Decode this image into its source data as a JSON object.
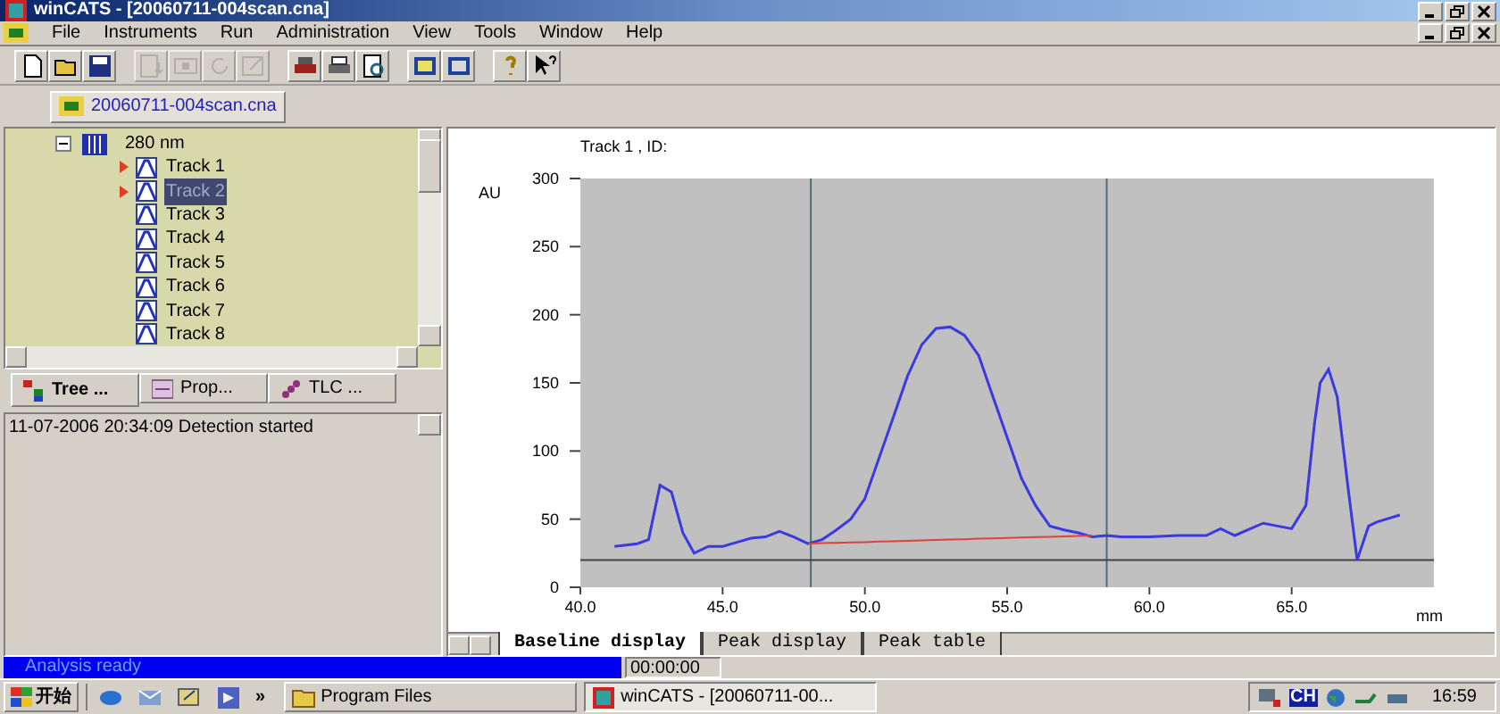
{
  "window": {
    "title": "winCATS - [20060711-004scan.cna]"
  },
  "menu": [
    "File",
    "Instruments",
    "Run",
    "Administration",
    "View",
    "Tools",
    "Window",
    "Help"
  ],
  "toolbar": [
    [
      {
        "kind": "new",
        "disabled": false
      },
      {
        "kind": "open",
        "disabled": false
      },
      {
        "kind": "save",
        "disabled": false
      }
    ],
    [
      {
        "kind": "list",
        "disabled": true
      },
      {
        "kind": "panel",
        "disabled": true
      },
      {
        "kind": "refresh",
        "disabled": true
      },
      {
        "kind": "edit",
        "disabled": true
      }
    ],
    [
      {
        "kind": "printer",
        "disabled": false
      },
      {
        "kind": "print",
        "disabled": false
      },
      {
        "kind": "preview",
        "disabled": false
      }
    ],
    [
      {
        "kind": "frame",
        "disabled": false
      },
      {
        "kind": "window",
        "disabled": false
      }
    ],
    [
      {
        "kind": "help",
        "disabled": false
      },
      {
        "kind": "context-help",
        "disabled": false
      }
    ]
  ],
  "document_tabs": [
    {
      "label": "20060711-004scan.cna",
      "selected": true
    }
  ],
  "tree": {
    "items": [
      {
        "label": "280 nm",
        "expanded": true,
        "children": [
          {
            "label": "Track 1",
            "marked": true,
            "selected": false
          },
          {
            "label": "Track 2",
            "marked": true,
            "selected": true
          },
          {
            "label": "Track 3",
            "marked": false,
            "selected": false
          },
          {
            "label": "Track 4",
            "marked": false,
            "selected": false
          },
          {
            "label": "Track 5",
            "marked": false,
            "selected": false
          },
          {
            "label": "Track 6",
            "marked": false,
            "selected": false
          },
          {
            "label": "Track 7",
            "marked": false,
            "selected": false
          },
          {
            "label": "Track 8",
            "marked": false,
            "selected": false
          }
        ]
      }
    ]
  },
  "panel_tabs": [
    {
      "label": "Tree ...",
      "kind": "tree",
      "selected": true
    },
    {
      "label": "Prop...",
      "kind": "properties",
      "selected": false
    },
    {
      "label": "TLC ...",
      "kind": "tlc",
      "selected": false
    }
  ],
  "log": [
    "11-07-2006 20:34:09 Detection started"
  ],
  "chart": {
    "chart_data": {
      "type": "line",
      "title": "Track 1 , ID:",
      "xlabel": "mm",
      "ylabel": "AU",
      "xlim": [
        40,
        70
      ],
      "ylim": [
        0,
        300
      ],
      "xticks": [
        {
          "value": 40,
          "label": "40.0"
        },
        {
          "value": 45,
          "label": "45.0"
        },
        {
          "value": 50,
          "label": "50.0"
        },
        {
          "value": 55,
          "label": "55.0"
        },
        {
          "value": 60,
          "label": "60.0"
        },
        {
          "value": 65,
          "label": "65.0"
        }
      ],
      "yticks": [
        0,
        50,
        100,
        150,
        200,
        250,
        300
      ],
      "x": [
        41.2,
        42,
        42.4,
        42.8,
        43.2,
        43.6,
        44,
        44.5,
        45,
        45.5,
        46,
        46.5,
        47,
        47.5,
        48,
        48.5,
        49,
        49.5,
        50,
        50.5,
        51,
        51.5,
        52,
        52.5,
        53,
        53.5,
        54,
        54.5,
        55,
        55.5,
        56,
        56.5,
        57,
        57.5,
        58,
        58.5,
        59,
        60,
        61,
        62,
        62.5,
        63,
        64,
        64.5,
        65,
        65.5,
        65.8,
        66,
        66.3,
        66.6,
        67,
        67.3,
        67.7,
        68,
        68.8
      ],
      "series": [
        {
          "color": "#3a3ae0",
          "values": [
            30,
            32,
            35,
            75,
            70,
            40,
            25,
            30,
            30,
            33,
            36,
            37,
            41,
            37,
            32,
            35,
            42,
            50,
            65,
            95,
            125,
            155,
            178,
            190,
            191,
            185,
            170,
            140,
            110,
            80,
            60,
            45,
            42,
            40,
            37,
            38,
            37,
            37,
            38,
            38,
            43,
            38,
            47,
            45,
            43,
            60,
            120,
            150,
            160,
            140,
            70,
            20,
            45,
            48,
            53
          ]
        },
        {
          "color": "#e04040",
          "values": [
            null,
            null,
            null,
            null,
            null,
            null,
            null,
            null,
            null,
            null,
            null,
            null,
            null,
            null,
            32,
            32.3,
            32.6,
            32.9,
            33.2,
            33.5,
            33.8,
            34.1,
            34.4,
            34.7,
            35,
            35.3,
            35.6,
            35.9,
            36.2,
            36.5,
            36.8,
            37.1,
            37.4,
            37.7,
            38,
            null,
            null,
            null,
            null,
            null,
            null,
            null,
            null,
            null,
            null,
            null,
            null,
            null,
            null,
            null,
            null,
            null,
            null,
            null,
            null
          ]
        }
      ],
      "ref_lines": [
        {
          "axis": "x",
          "value": 48.1
        },
        {
          "axis": "x",
          "value": 58.5
        },
        {
          "axis": "y",
          "value": 20
        }
      ]
    },
    "tabs": [
      {
        "label": "Baseline display",
        "selected": true
      },
      {
        "label": "Peak display",
        "selected": false
      },
      {
        "label": "Peak table",
        "selected": false
      }
    ]
  },
  "status_bar": {
    "message": "Analysis ready",
    "time": "00:00:00"
  },
  "taskbar": {
    "start": "开始",
    "quick_launch": [
      {
        "kind": "browser"
      },
      {
        "kind": "mail"
      },
      {
        "kind": "desktop"
      },
      {
        "kind": "media"
      }
    ],
    "more": "»",
    "buttons": [
      {
        "label": "Program Files",
        "kind": "folder",
        "selected": false
      },
      {
        "label": "winCATS - [20060711-00...",
        "kind": "app",
        "selected": true
      }
    ],
    "tray_language": "CH",
    "clock": "16:59"
  }
}
